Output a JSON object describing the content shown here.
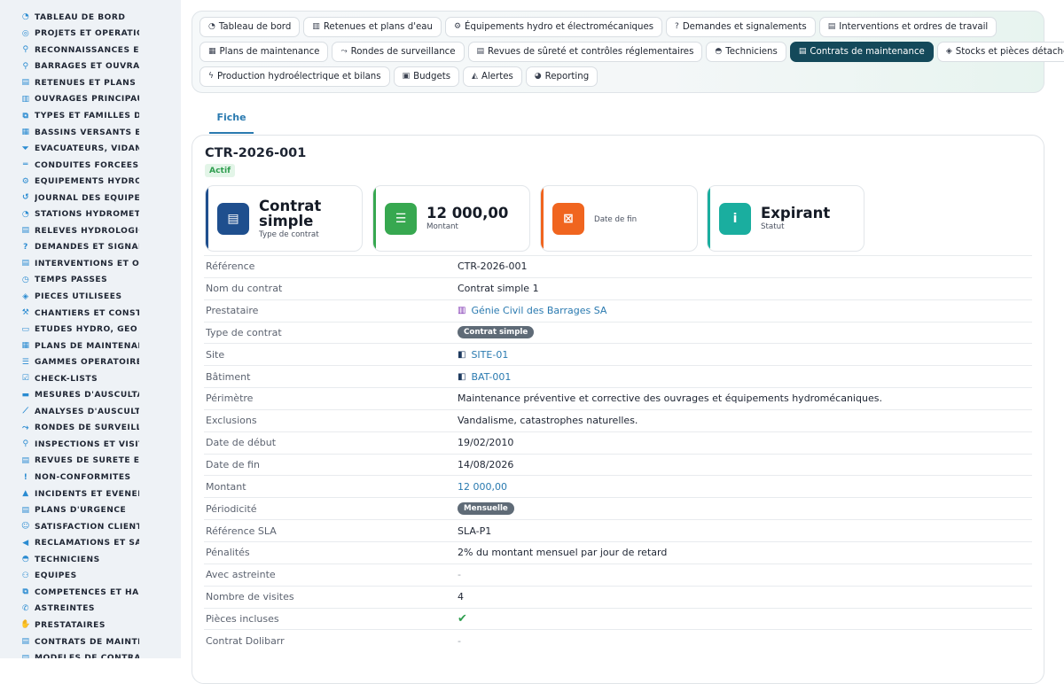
{
  "sidebar": {
    "items": [
      {
        "label": "TABLEAU DE BORD",
        "icon": "dashboard-icon",
        "glyph": "◔"
      },
      {
        "label": "PROJETS ET OPÉRATIONS",
        "icon": "bullseye-icon",
        "glyph": "◎"
      },
      {
        "label": "RECONNAISSANCES ET VISITES",
        "icon": "binoculars-icon",
        "glyph": "⚲"
      },
      {
        "label": "BARRAGES ET OUVRAGES",
        "icon": "map-marker-icon",
        "glyph": "⚲"
      },
      {
        "label": "RETENUES ET PLANS D'EAU",
        "icon": "water-icon",
        "glyph": "▤"
      },
      {
        "label": "OUVRAGES PRINCIPAUX",
        "icon": "building-icon",
        "glyph": "▥"
      },
      {
        "label": "TYPES ET FAMILLES D'OUVRAGES",
        "icon": "sitemap-icon",
        "glyph": "⧉"
      },
      {
        "label": "BASSINS VERSANTS ET AFFLUENTS",
        "icon": "grid-icon",
        "glyph": "▦"
      },
      {
        "label": "ÉVACUATEURS, VIDANGES",
        "icon": "filter-icon",
        "glyph": "⏷"
      },
      {
        "label": "CONDUITES FORCÉES ET GALERIES",
        "icon": "pipe-icon",
        "glyph": "═"
      },
      {
        "label": "ÉQUIPEMENTS HYDRO ET ÉLECTROMÉCANIQUES",
        "icon": "cogs-icon",
        "glyph": "⚙"
      },
      {
        "label": "JOURNAL DES ÉQUIPEMENTS",
        "icon": "history-icon",
        "glyph": "↺"
      },
      {
        "label": "STATIONS HYDROMÉTRIQUES",
        "icon": "gauge-icon",
        "glyph": "◔"
      },
      {
        "label": "RELEVÉS HYDROLOGIQUES",
        "icon": "clipboard-icon",
        "glyph": "▤"
      },
      {
        "label": "DEMANDES ET SIGNALEMENTS",
        "icon": "question-icon",
        "glyph": "?"
      },
      {
        "label": "INTERVENTIONS ET ORDRES DE TRAVAIL",
        "icon": "clipboard-check-icon",
        "glyph": "▤"
      },
      {
        "label": "TEMPS PASSÉS",
        "icon": "clock-icon",
        "glyph": "◷"
      },
      {
        "label": "PIÈCES UTILISÉES",
        "icon": "cube-icon",
        "glyph": "◈"
      },
      {
        "label": "CHANTIERS ET CONSTRUCTIONS",
        "icon": "hammer-icon",
        "glyph": "⚒"
      },
      {
        "label": "ÉTUDES HYDRO, GÉO ET ENVIRONNEMENT",
        "icon": "book-icon",
        "glyph": "▭"
      },
      {
        "label": "PLANS DE MAINTENANCE",
        "icon": "calendar-icon",
        "glyph": "▦"
      },
      {
        "label": "GAMMES OPÉRATOIRES",
        "icon": "list-icon",
        "glyph": "☰"
      },
      {
        "label": "CHECK-LISTS",
        "icon": "checklist-icon",
        "glyph": "☑"
      },
      {
        "label": "MESURES D'AUSCULTATION",
        "icon": "ruler-icon",
        "glyph": "▬"
      },
      {
        "label": "ANALYSES D'AUSCULTATION",
        "icon": "chart-line-icon",
        "glyph": "⟋"
      },
      {
        "label": "RONDES DE SURVEILLANCE",
        "icon": "route-icon",
        "glyph": "⤳"
      },
      {
        "label": "INSPECTIONS ET VISITES",
        "icon": "search-icon",
        "glyph": "⚲"
      },
      {
        "label": "REVUES DE SÛRETÉ ET CONTRÔLES",
        "icon": "file-shield-icon",
        "glyph": "▤"
      },
      {
        "label": "NON-CONFORMITÉS",
        "icon": "exclamation-icon",
        "glyph": "!"
      },
      {
        "label": "INCIDENTS ET ÉVÉNEMENTS",
        "icon": "warning-icon",
        "glyph": "▲"
      },
      {
        "label": "PLANS D'URGENCE",
        "icon": "file-alert-icon",
        "glyph": "▤"
      },
      {
        "label": "SATISFACTION CLIENT",
        "icon": "smile-icon",
        "glyph": "☺"
      },
      {
        "label": "RÉCLAMATIONS ET SAV",
        "icon": "megaphone-icon",
        "glyph": "◀"
      },
      {
        "label": "TECHNICIENS",
        "icon": "hard-hat-icon",
        "glyph": "◓"
      },
      {
        "label": "ÉQUIPES",
        "icon": "users-icon",
        "glyph": "⚇"
      },
      {
        "label": "COMPÉTENCES ET HABILITATIONS",
        "icon": "sitemap-icon",
        "glyph": "⧉"
      },
      {
        "label": "ASTREINTES",
        "icon": "phone-icon",
        "glyph": "✆"
      },
      {
        "label": "PRESTATAIRES",
        "icon": "handshake-icon",
        "glyph": "✋"
      },
      {
        "label": "CONTRATS DE MAINTENANCE",
        "icon": "file-contract-icon",
        "glyph": "▤"
      },
      {
        "label": "MODÈLES DE CONTRATS",
        "icon": "file-icon",
        "glyph": "▤"
      }
    ]
  },
  "topnav": {
    "rows": [
      [
        {
          "label": "Tableau de bord",
          "icon": "dashboard-icon",
          "glyph": "◔"
        },
        {
          "label": "Retenues et plans d'eau",
          "icon": "building-icon",
          "glyph": "▥"
        },
        {
          "label": "Équipements hydro et électromécaniques",
          "icon": "cogs-icon",
          "glyph": "⚙"
        },
        {
          "label": "Demandes et signalements",
          "icon": "question-icon",
          "glyph": "?"
        },
        {
          "label": "Interventions et ordres de travail",
          "icon": "clipboard-icon",
          "glyph": "▤"
        }
      ],
      [
        {
          "label": "Plans de maintenance",
          "icon": "calendar-icon",
          "glyph": "▦"
        },
        {
          "label": "Rondes de surveillance",
          "icon": "route-icon",
          "glyph": "⤳"
        },
        {
          "label": "Revues de sûreté et contrôles réglementaires",
          "icon": "file-shield-icon",
          "glyph": "▤"
        },
        {
          "label": "Techniciens",
          "icon": "hard-hat-icon",
          "glyph": "◓"
        },
        {
          "label": "Contrats de maintenance",
          "icon": "file-contract-icon",
          "glyph": "▤",
          "active": true
        },
        {
          "label": "Stocks et pièces détachées",
          "icon": "cubes-icon",
          "glyph": "◈"
        }
      ],
      [
        {
          "label": "Production hydroélectrique et bilans",
          "icon": "bolt-icon",
          "glyph": "ϟ"
        },
        {
          "label": "Budgets",
          "icon": "money-icon",
          "glyph": "▣"
        },
        {
          "label": "Alertes",
          "icon": "bell-icon",
          "glyph": "◭"
        },
        {
          "label": "Reporting",
          "icon": "pie-chart-icon",
          "glyph": "◕"
        }
      ]
    ]
  },
  "tabs": {
    "fiche": "Fiche"
  },
  "record": {
    "title": "CTR-2026-001",
    "status": "Actif"
  },
  "stats": [
    {
      "value": "Contrat simple",
      "caption": "Type de contrat",
      "icon": "file-contract-icon",
      "glyph": "▤",
      "color": "#1f4f8e"
    },
    {
      "value": "12 000,00",
      "caption": "Montant",
      "icon": "coins-icon",
      "glyph": "☰",
      "color": "#37a850"
    },
    {
      "value": "",
      "caption": "Date de fin",
      "icon": "calendar-x-icon",
      "glyph": "⊠",
      "color": "#f0651f"
    },
    {
      "value": "Expirant",
      "caption": "Statut",
      "icon": "info-icon",
      "glyph": "i",
      "color": "#1aae9f"
    }
  ],
  "details": [
    {
      "label": "Référence",
      "value": "CTR-2026-001",
      "kind": "text"
    },
    {
      "label": "Nom du contrat",
      "value": "Contrat simple 1",
      "kind": "text"
    },
    {
      "label": "Prestataire",
      "value": "Génie Civil des Barrages SA",
      "kind": "link",
      "icon": "building-icon",
      "glyph": "▥",
      "iconColor": "#7b2fb0"
    },
    {
      "label": "Type de contrat",
      "value": "Contrat simple",
      "kind": "pill"
    },
    {
      "label": "Site",
      "value": "SITE-01",
      "kind": "link",
      "icon": "map-icon",
      "glyph": "◧",
      "iconColor": "#1e3a5f"
    },
    {
      "label": "Bâtiment",
      "value": "BAT-001",
      "kind": "link",
      "icon": "map-icon",
      "glyph": "◧",
      "iconColor": "#1e3a5f"
    },
    {
      "label": "Périmètre",
      "value": "Maintenance préventive et corrective des ouvrages et équipements hydromécaniques.",
      "kind": "text"
    },
    {
      "label": "Exclusions",
      "value": "Vandalisme, catastrophes naturelles.",
      "kind": "text"
    },
    {
      "label": "Date de début",
      "value": "19/02/2010",
      "kind": "text"
    },
    {
      "label": "Date de fin",
      "value": "14/08/2026",
      "kind": "text"
    },
    {
      "label": "Montant",
      "value": "12 000,00",
      "kind": "money"
    },
    {
      "label": "Périodicité",
      "value": "Mensuelle",
      "kind": "pill"
    },
    {
      "label": "Référence SLA",
      "value": "SLA-P1",
      "kind": "text"
    },
    {
      "label": "Pénalités",
      "value": "2% du montant mensuel par jour de retard",
      "kind": "text"
    },
    {
      "label": "Avec astreinte",
      "value": "-",
      "kind": "dash"
    },
    {
      "label": "Nombre de visites",
      "value": "4",
      "kind": "text"
    },
    {
      "label": "Pièces incluses",
      "value": "✔",
      "kind": "check",
      "icon": "check-icon"
    },
    {
      "label": "Contrat Dolibarr",
      "value": "-",
      "kind": "dash"
    }
  ]
}
